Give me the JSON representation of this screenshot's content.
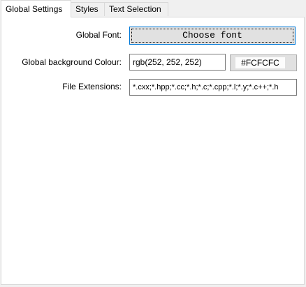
{
  "tabs": [
    {
      "label": "Global Settings",
      "active": true
    },
    {
      "label": "Styles",
      "active": false
    },
    {
      "label": "Text Selection",
      "active": false
    }
  ],
  "global_font": {
    "label": "Global Font:",
    "button_label": "Choose font"
  },
  "background": {
    "label": "Global background Colour:",
    "value": "rgb(252, 252, 252)",
    "swatch_label": "#FCFCFC",
    "swatch_color": "#FCFCFC"
  },
  "extensions": {
    "label": "File Extensions:",
    "value": "*.cxx;*.hpp;*.cc;*.h;*.c;*.cpp;*.l;*.y;*.c++;*.h"
  },
  "colors": {
    "focus_border": "#0078d7",
    "panel_bg": "#ffffff",
    "window_bg": "#f0f0f0"
  }
}
